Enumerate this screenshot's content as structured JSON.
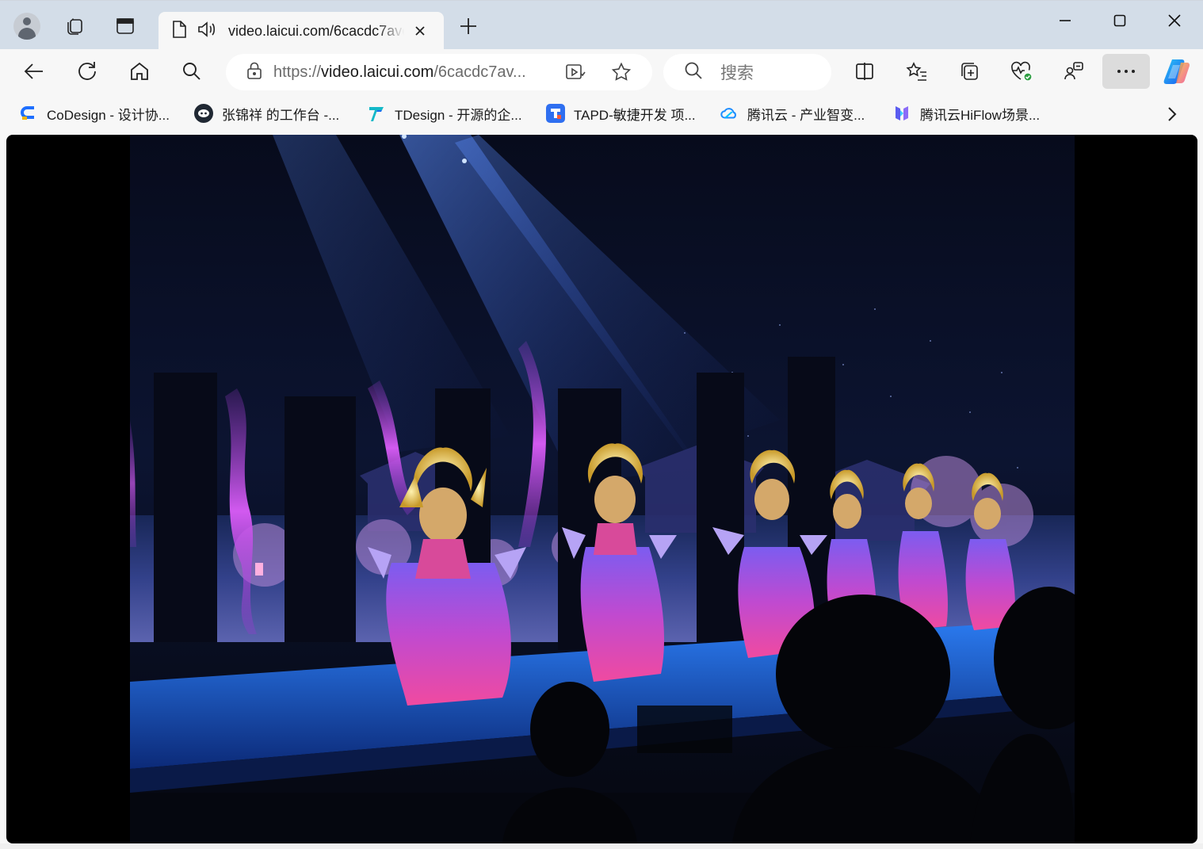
{
  "tab": {
    "title": "video.laicui.com/6cacdc7avc"
  },
  "address_bar": {
    "url_scheme": "https://",
    "url_host": "video.laicui.com",
    "url_path": "/6cacdc7av..."
  },
  "search_box": {
    "placeholder": "搜索"
  },
  "bookmarks": [
    {
      "label": "CoDesign - 设计协...",
      "color": "#1e6fff"
    },
    {
      "label": "张锦祥 的工作台 -...",
      "color": "#202833"
    },
    {
      "label": "TDesign - 开源的企...",
      "color": "#1aa6ff"
    },
    {
      "label": "TAPD-敏捷开发 项...",
      "color": "#2f6ff0"
    },
    {
      "label": "腾讯云 - 产业智变...",
      "color": "#1b8cff"
    },
    {
      "label": "腾讯云HiFlow场景...",
      "color": "#5a5cf0"
    }
  ],
  "colors": {
    "tabstrip": "#d3dde8",
    "toolbar": "#f7f7f7",
    "copilot_accent": "#1a7cf5"
  }
}
